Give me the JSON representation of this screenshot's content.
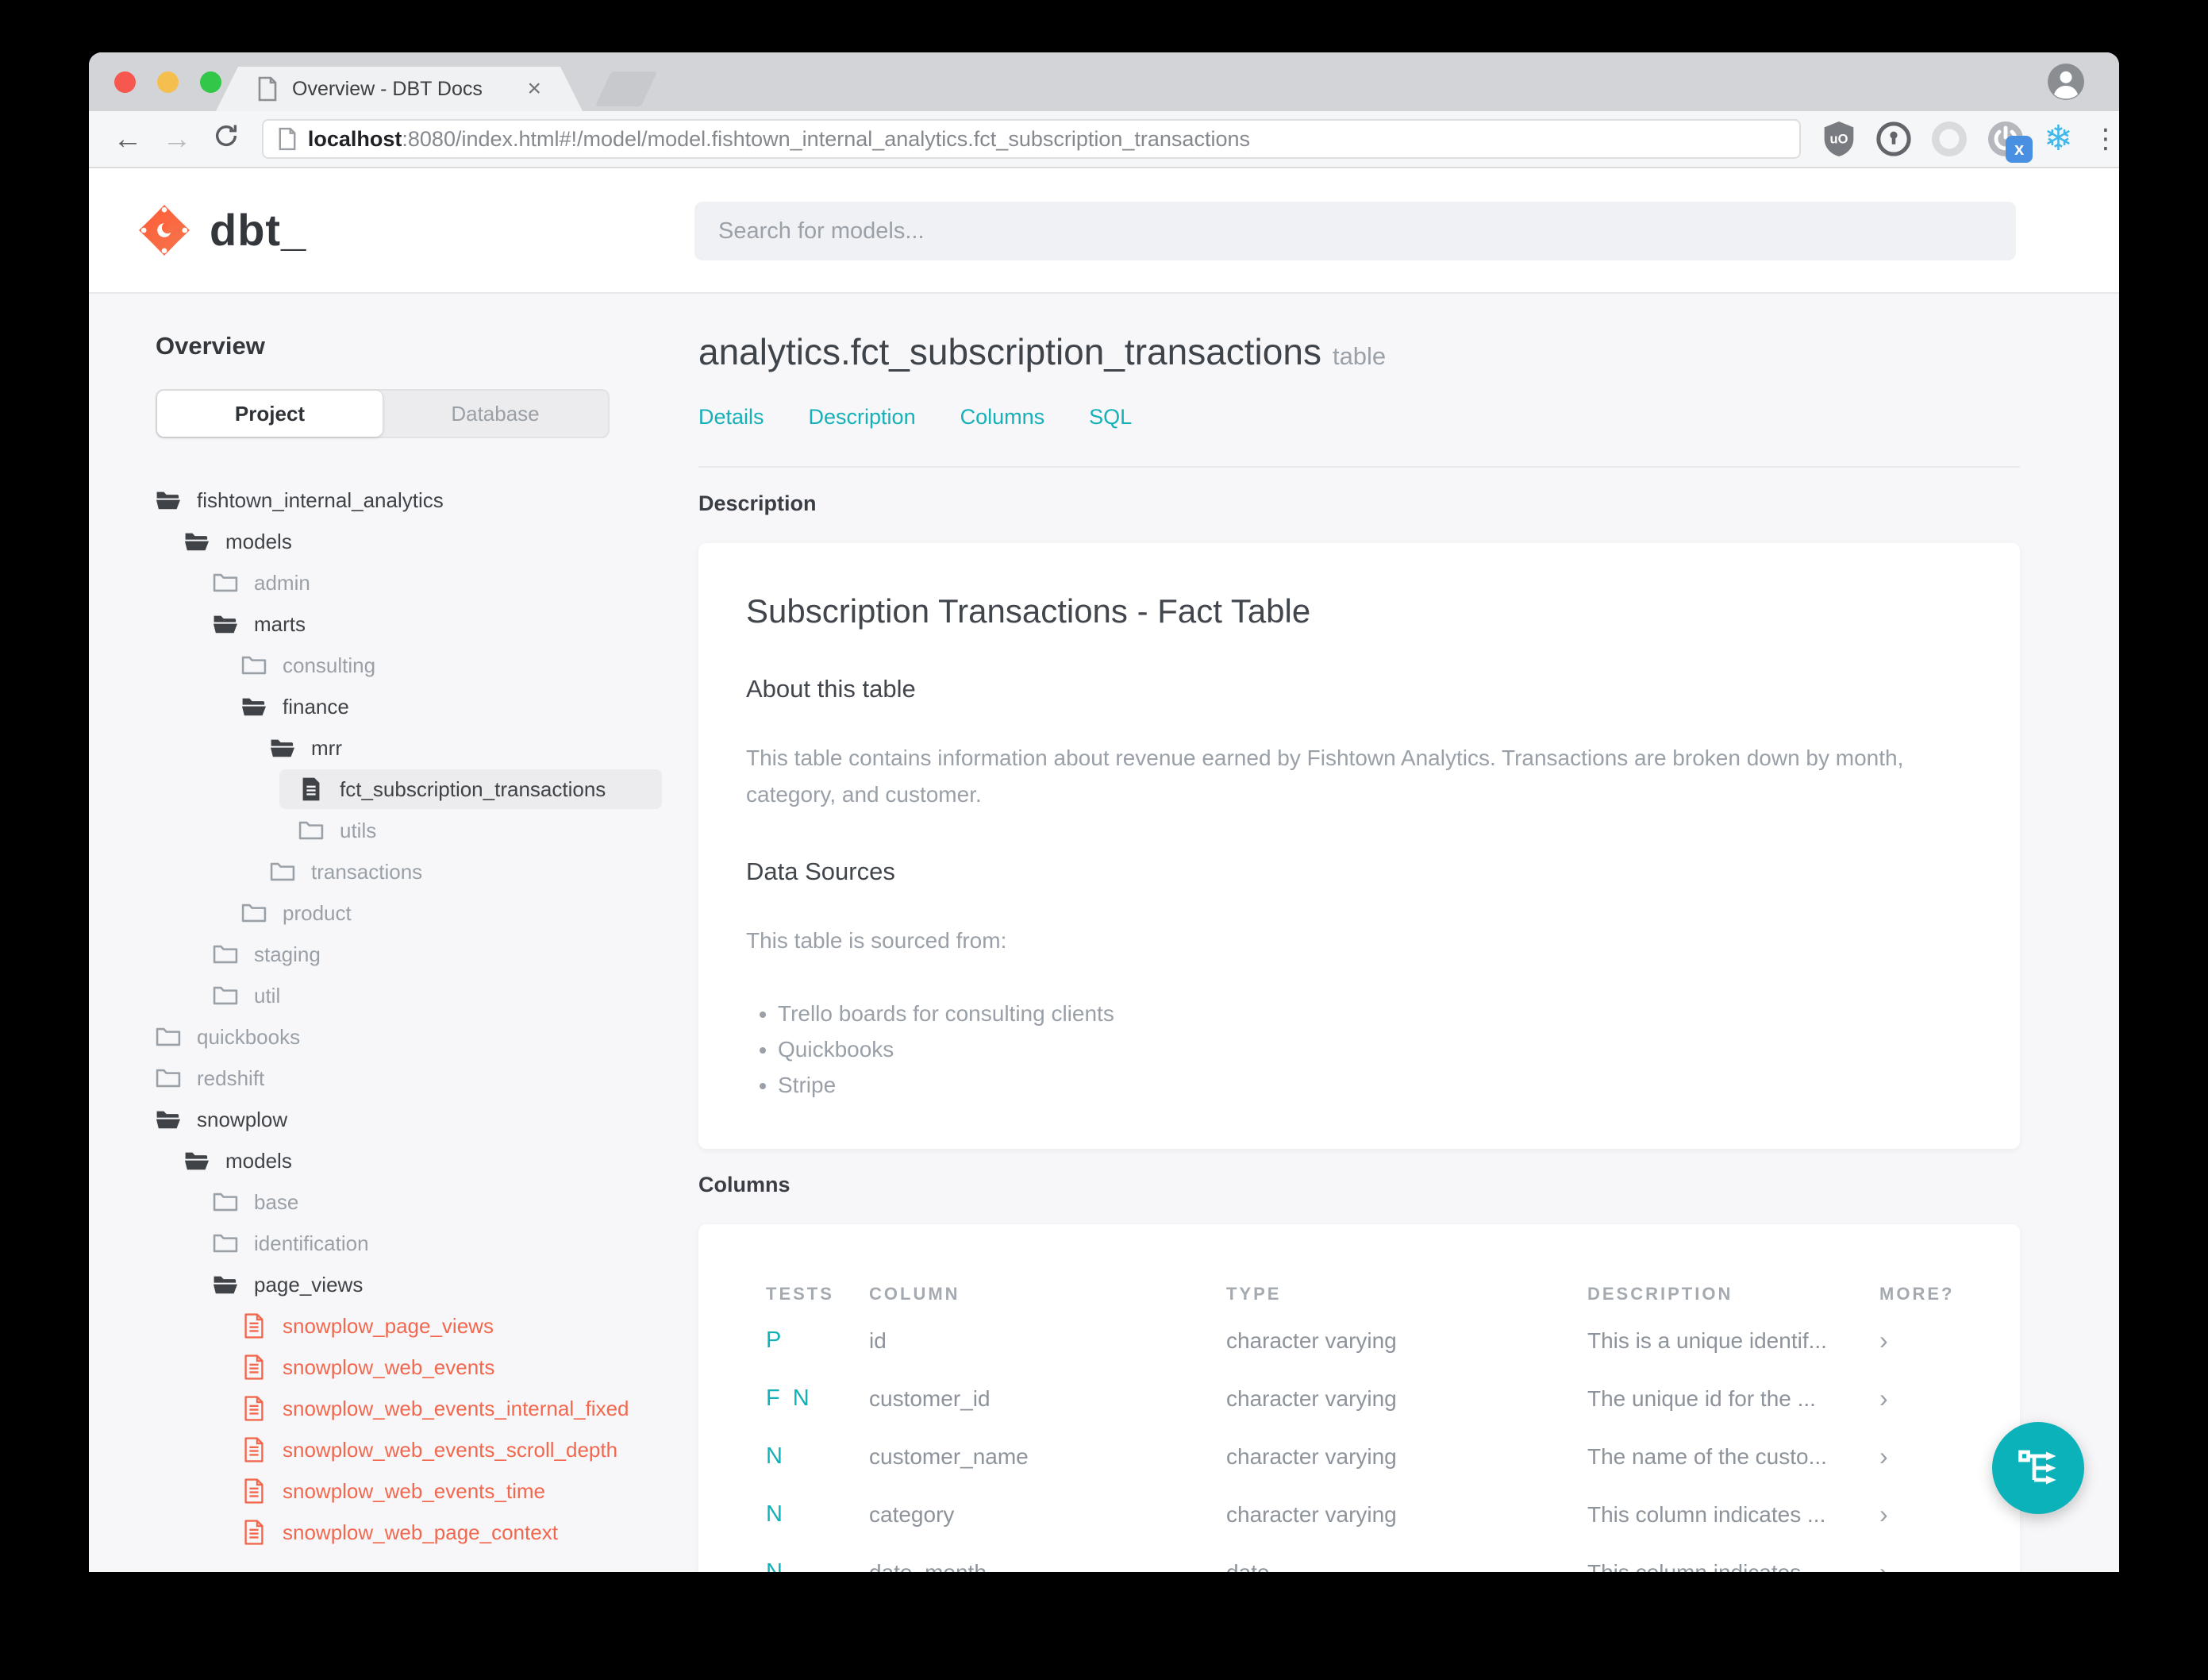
{
  "browser": {
    "tab_title": "Overview - DBT Docs",
    "tab_close": "×",
    "url_host": "localhost",
    "url_rest": ":8080/index.html#!/model/model.fishtown_internal_analytics.fct_subscription_transactions",
    "back_glyph": "←",
    "forward_glyph": "→",
    "kebab_glyph": "⋮",
    "snowflake_glyph": "❄"
  },
  "header": {
    "logo_text": "dbt_",
    "search_placeholder": "Search for models..."
  },
  "sidebar": {
    "heading": "Overview",
    "tabs": [
      {
        "label": "Project",
        "active": true
      },
      {
        "label": "Database",
        "active": false
      }
    ],
    "tree": [
      {
        "label": "fishtown_internal_analytics",
        "level": 0,
        "icon": "folder-open",
        "tone": "dark"
      },
      {
        "label": "models",
        "level": 1,
        "icon": "folder-open",
        "tone": "dark"
      },
      {
        "label": "admin",
        "level": 2,
        "icon": "folder-closed",
        "tone": "gray"
      },
      {
        "label": "marts",
        "level": 2,
        "icon": "folder-open",
        "tone": "dark"
      },
      {
        "label": "consulting",
        "level": 3,
        "icon": "folder-closed",
        "tone": "gray"
      },
      {
        "label": "finance",
        "level": 3,
        "icon": "folder-open",
        "tone": "dark"
      },
      {
        "label": "mrr",
        "level": 4,
        "icon": "folder-open",
        "tone": "dark"
      },
      {
        "label": "fct_subscription_transactions",
        "level": 5,
        "icon": "file-solid",
        "tone": "dark",
        "selected": true
      },
      {
        "label": "utils",
        "level": 5,
        "icon": "folder-closed",
        "tone": "gray"
      },
      {
        "label": "transactions",
        "level": 4,
        "icon": "folder-closed",
        "tone": "gray"
      },
      {
        "label": "product",
        "level": 3,
        "icon": "folder-closed",
        "tone": "gray"
      },
      {
        "label": "staging",
        "level": 2,
        "icon": "folder-closed",
        "tone": "gray"
      },
      {
        "label": "util",
        "level": 2,
        "icon": "folder-closed",
        "tone": "gray"
      },
      {
        "label": "quickbooks",
        "level": 0,
        "icon": "folder-closed",
        "tone": "gray"
      },
      {
        "label": "redshift",
        "level": 0,
        "icon": "folder-closed",
        "tone": "gray"
      },
      {
        "label": "snowplow",
        "level": 0,
        "icon": "folder-open",
        "tone": "dark"
      },
      {
        "label": "models",
        "level": 1,
        "icon": "folder-open",
        "tone": "dark"
      },
      {
        "label": "base",
        "level": 2,
        "icon": "folder-closed",
        "tone": "gray"
      },
      {
        "label": "identification",
        "level": 2,
        "icon": "folder-closed",
        "tone": "gray"
      },
      {
        "label": "page_views",
        "level": 2,
        "icon": "folder-open",
        "tone": "dark"
      },
      {
        "label": "snowplow_page_views",
        "level": 3,
        "icon": "file-outline",
        "tone": "red"
      },
      {
        "label": "snowplow_web_events",
        "level": 3,
        "icon": "file-outline",
        "tone": "red"
      },
      {
        "label": "snowplow_web_events_internal_fixed",
        "level": 3,
        "icon": "file-outline",
        "tone": "red"
      },
      {
        "label": "snowplow_web_events_scroll_depth",
        "level": 3,
        "icon": "file-outline",
        "tone": "red"
      },
      {
        "label": "snowplow_web_events_time",
        "level": 3,
        "icon": "file-outline",
        "tone": "red"
      },
      {
        "label": "snowplow_web_page_context",
        "level": 3,
        "icon": "file-outline",
        "tone": "red"
      }
    ]
  },
  "main": {
    "title": "analytics.fct_subscription_transactions",
    "title_badge": "table",
    "nav": [
      {
        "label": "Details"
      },
      {
        "label": "Description"
      },
      {
        "label": "Columns"
      },
      {
        "label": "SQL"
      }
    ],
    "description_heading": "Description",
    "doc": {
      "title": "Subscription Transactions - Fact Table",
      "about_heading": "About this table",
      "about_text": "This table contains information about revenue earned by Fishtown Analytics. Transactions are broken down by month, category, and customer.",
      "sources_heading": "Data Sources",
      "sources_intro": "This table is sourced from:",
      "sources": [
        {
          "text": "Trello boards for consulting clients"
        },
        {
          "text": "Quickbooks"
        },
        {
          "text": "Stripe"
        }
      ]
    },
    "columns_heading": "Columns",
    "table": {
      "headers": [
        {
          "label": "TESTS"
        },
        {
          "label": "COLUMN"
        },
        {
          "label": "TYPE"
        },
        {
          "label": "DESCRIPTION"
        },
        {
          "label": "MORE?"
        }
      ],
      "rows": [
        {
          "tests": "P",
          "column": "id",
          "type": "character varying",
          "description": "This is a unique identif...",
          "more": "›"
        },
        {
          "tests": "F N",
          "column": "customer_id",
          "type": "character varying",
          "description": "The unique id for the ...",
          "more": "›"
        },
        {
          "tests": "N",
          "column": "customer_name",
          "type": "character varying",
          "description": "The name of the custo...",
          "more": "›"
        },
        {
          "tests": "N",
          "column": "category",
          "type": "character varying",
          "description": "This column indicates ...",
          "more": "›"
        },
        {
          "tests": "N",
          "column": "date_month",
          "type": "date",
          "description": "This column indicates ...",
          "more": "›"
        }
      ]
    }
  },
  "colors": {
    "accent_teal": "#12b0b9",
    "accent_orange": "#f2684e",
    "file_red": "#f2684e"
  }
}
